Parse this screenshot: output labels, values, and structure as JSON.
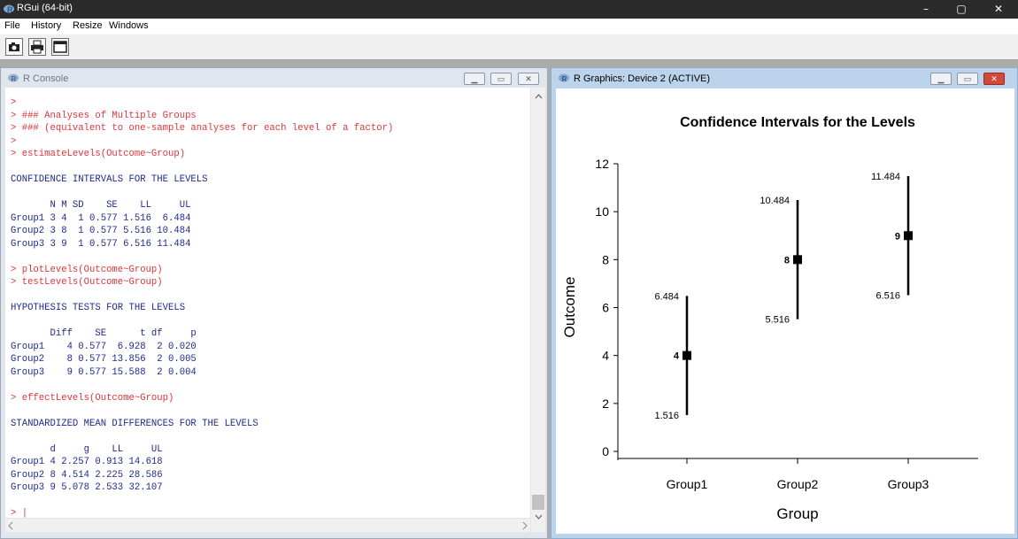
{
  "window": {
    "title": "RGui (64-bit)",
    "minimize": "–",
    "maximize": "▢",
    "close": "✕"
  },
  "menu": [
    "File",
    "History",
    "Resize",
    "Windows"
  ],
  "console": {
    "title": "R Console",
    "lines": [
      {
        "t": ">",
        "k": "cmd"
      },
      {
        "t": "> ### Analyses of Multiple Groups",
        "k": "cmd"
      },
      {
        "t": "> ### (equivalent to one-sample analyses for each level of a factor)",
        "k": "cmd"
      },
      {
        "t": ">",
        "k": "cmd"
      },
      {
        "t": "> estimateLevels(Outcome~Group)",
        "k": "cmd"
      },
      {
        "t": "",
        "k": "out"
      },
      {
        "t": "CONFIDENCE INTERVALS FOR THE LEVELS",
        "k": "out"
      },
      {
        "t": "",
        "k": "out"
      },
      {
        "t": "       N M SD    SE    LL     UL",
        "k": "out"
      },
      {
        "t": "Group1 3 4  1 0.577 1.516  6.484",
        "k": "out"
      },
      {
        "t": "Group2 3 8  1 0.577 5.516 10.484",
        "k": "out"
      },
      {
        "t": "Group3 3 9  1 0.577 6.516 11.484",
        "k": "out"
      },
      {
        "t": "",
        "k": "out"
      },
      {
        "t": "> plotLevels(Outcome~Group)",
        "k": "cmd"
      },
      {
        "t": "> testLevels(Outcome~Group)",
        "k": "cmd"
      },
      {
        "t": "",
        "k": "out"
      },
      {
        "t": "HYPOTHESIS TESTS FOR THE LEVELS",
        "k": "out"
      },
      {
        "t": "",
        "k": "out"
      },
      {
        "t": "       Diff    SE      t df     p",
        "k": "out"
      },
      {
        "t": "Group1    4 0.577  6.928  2 0.020",
        "k": "out"
      },
      {
        "t": "Group2    8 0.577 13.856  2 0.005",
        "k": "out"
      },
      {
        "t": "Group3    9 0.577 15.588  2 0.004",
        "k": "out"
      },
      {
        "t": "",
        "k": "out"
      },
      {
        "t": "> effectLevels(Outcome~Group)",
        "k": "cmd"
      },
      {
        "t": "",
        "k": "out"
      },
      {
        "t": "STANDARDIZED MEAN DIFFERENCES FOR THE LEVELS",
        "k": "out"
      },
      {
        "t": "",
        "k": "out"
      },
      {
        "t": "       d     g    LL     UL",
        "k": "out"
      },
      {
        "t": "Group1 4 2.257 0.913 14.618",
        "k": "out"
      },
      {
        "t": "Group2 8 4.514 2.225 28.586",
        "k": "out"
      },
      {
        "t": "Group3 9 5.078 2.533 32.107",
        "k": "out"
      },
      {
        "t": "",
        "k": "out"
      },
      {
        "t": "> |",
        "k": "cmd"
      }
    ]
  },
  "graphics": {
    "title": "R Graphics: Device 2 (ACTIVE)"
  },
  "chart_data": {
    "type": "errorbar",
    "title": "Confidence Intervals for the Levels",
    "xlabel": "Group",
    "ylabel": "Outcome",
    "ylim": [
      0,
      12
    ],
    "yticks": [
      "0",
      "2",
      "4",
      "6",
      "8",
      "10",
      "12"
    ],
    "categories": [
      "Group1",
      "Group2",
      "Group3"
    ],
    "values": [
      4,
      8,
      9
    ],
    "value_labels": [
      "4",
      "8",
      "9"
    ],
    "lower": [
      1.516,
      5.516,
      6.516
    ],
    "lower_labels": [
      "1.516",
      "5.516",
      "6.516"
    ],
    "upper": [
      6.484,
      10.484,
      11.484
    ],
    "upper_labels": [
      "6.484",
      "10.484",
      "11.484"
    ],
    "grid": false
  }
}
